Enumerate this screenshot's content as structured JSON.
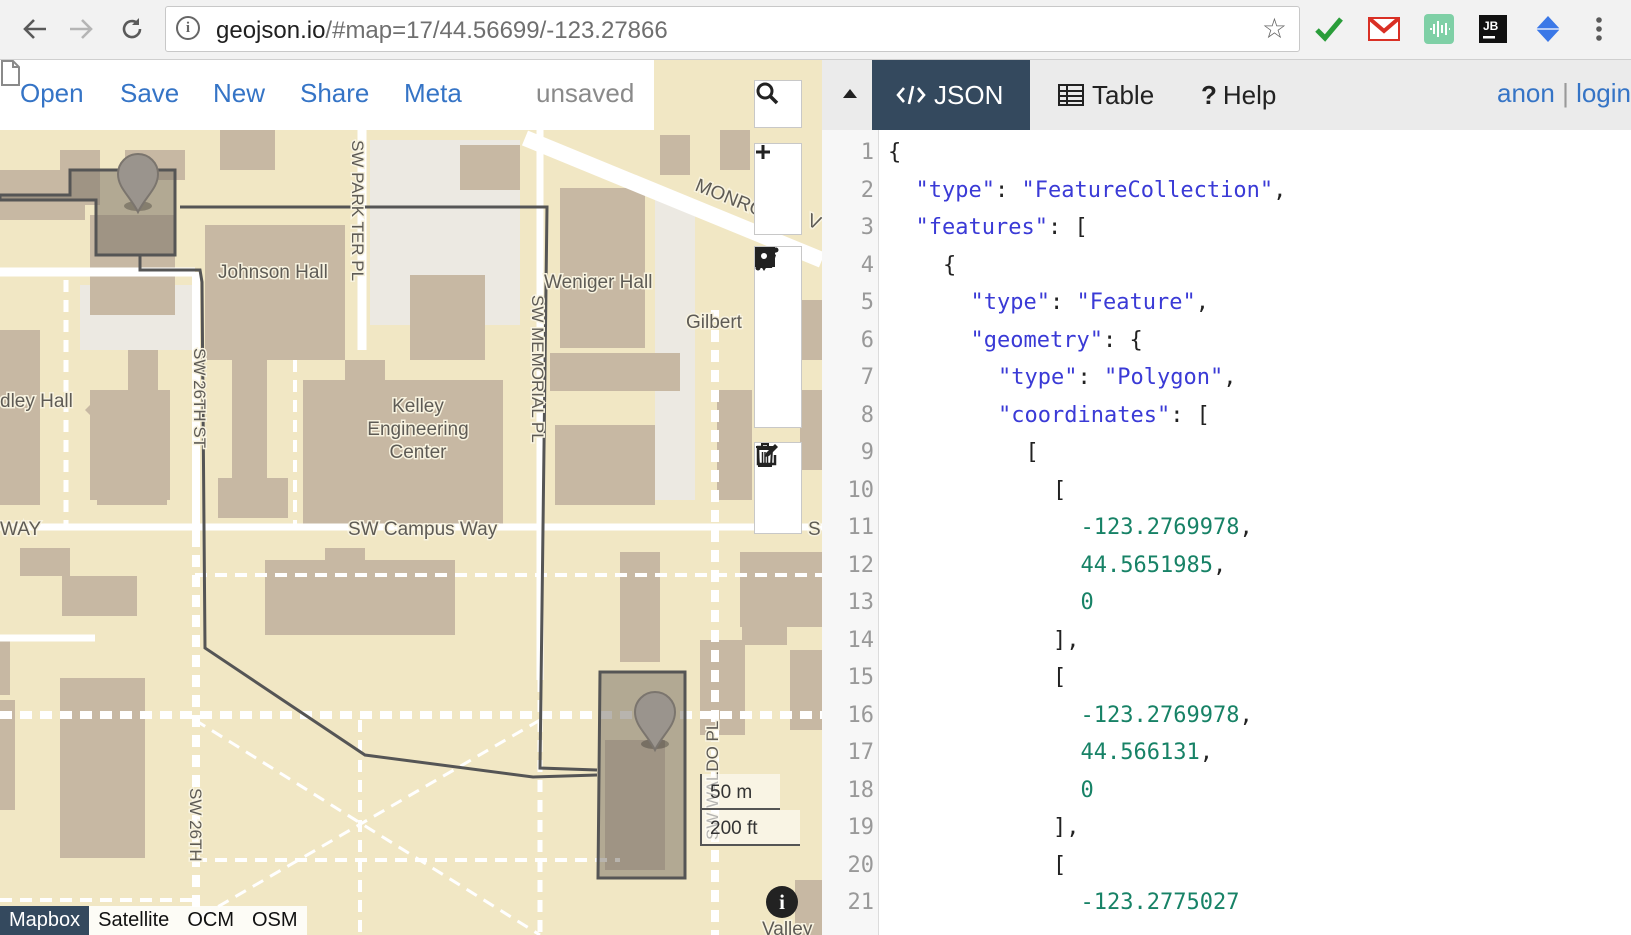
{
  "browser": {
    "url_host": "geojson.io",
    "url_rest": "/#map=17/44.56699/-123.27866"
  },
  "app": {
    "menu": {
      "open": "Open",
      "save": "Save",
      "new": "New",
      "share": "Share",
      "meta": "Meta",
      "unsaved": "unsaved"
    },
    "tabs": {
      "json": "JSON",
      "table": "Table",
      "help": "Help"
    },
    "account": {
      "anon": "anon",
      "sep": "|",
      "login": "login"
    }
  },
  "map": {
    "labels": {
      "johnson_hall": "Johnson Hall",
      "weniger_hall": "Weniger Hall",
      "gilbert": "Gilbert",
      "dley_hall": "dley Hall",
      "kelley_1": "Kelley",
      "kelley_2": "Engineering",
      "kelley_3": "Center",
      "campus_way": "SW Campus Way",
      "way": "WAY",
      "park_ter": "SW PARK TER PL",
      "memorial": "SW MEMORIAL PL",
      "sw26th_a": "SW 26TH ST",
      "sw26th_b": "SW 26TH",
      "waldo": "SW WALDO PL",
      "monroe": "MONRO",
      "valley": "Valley",
      "sw_s": "S",
      "sw_v": "V"
    },
    "scale": {
      "metric": "50 m",
      "imperial": "200 ft"
    },
    "layers": [
      "Mapbox",
      "Satellite",
      "OCM",
      "OSM"
    ],
    "active_layer": "Mapbox"
  },
  "editor": {
    "lines": [
      {
        "n": "1",
        "indent": 0,
        "tokens": [
          [
            "p",
            "{"
          ]
        ]
      },
      {
        "n": "2",
        "indent": 1,
        "tokens": [
          [
            "k",
            "\"type\""
          ],
          [
            "p",
            ": "
          ],
          [
            "s",
            "\"FeatureCollection\""
          ],
          [
            "p",
            ","
          ]
        ]
      },
      {
        "n": "3",
        "indent": 1,
        "tokens": [
          [
            "k",
            "\"features\""
          ],
          [
            "p",
            ": ["
          ]
        ]
      },
      {
        "n": "4",
        "indent": 2,
        "tokens": [
          [
            "p",
            "{"
          ]
        ]
      },
      {
        "n": "5",
        "indent": 3,
        "tokens": [
          [
            "k",
            "\"type\""
          ],
          [
            "p",
            ": "
          ],
          [
            "s",
            "\"Feature\""
          ],
          [
            "p",
            ","
          ]
        ]
      },
      {
        "n": "6",
        "indent": 3,
        "tokens": [
          [
            "k",
            "\"geometry\""
          ],
          [
            "p",
            ": {"
          ]
        ]
      },
      {
        "n": "7",
        "indent": 4,
        "tokens": [
          [
            "k",
            "\"type\""
          ],
          [
            "p",
            ": "
          ],
          [
            "s",
            "\"Polygon\""
          ],
          [
            "p",
            ","
          ]
        ]
      },
      {
        "n": "8",
        "indent": 4,
        "tokens": [
          [
            "k",
            "\"coordinates\""
          ],
          [
            "p",
            ": ["
          ]
        ]
      },
      {
        "n": "9",
        "indent": 5,
        "tokens": [
          [
            "p",
            "["
          ]
        ]
      },
      {
        "n": "10",
        "indent": 6,
        "tokens": [
          [
            "p",
            "["
          ]
        ]
      },
      {
        "n": "11",
        "indent": 7,
        "tokens": [
          [
            "n",
            "-123.2769978"
          ],
          [
            "p",
            ","
          ]
        ]
      },
      {
        "n": "12",
        "indent": 7,
        "tokens": [
          [
            "n",
            "44.5651985"
          ],
          [
            "p",
            ","
          ]
        ]
      },
      {
        "n": "13",
        "indent": 7,
        "tokens": [
          [
            "n",
            "0"
          ]
        ]
      },
      {
        "n": "14",
        "indent": 6,
        "tokens": [
          [
            "p",
            "],"
          ]
        ]
      },
      {
        "n": "15",
        "indent": 6,
        "tokens": [
          [
            "p",
            "["
          ]
        ]
      },
      {
        "n": "16",
        "indent": 7,
        "tokens": [
          [
            "n",
            "-123.2769978"
          ],
          [
            "p",
            ","
          ]
        ]
      },
      {
        "n": "17",
        "indent": 7,
        "tokens": [
          [
            "n",
            "44.566131"
          ],
          [
            "p",
            ","
          ]
        ]
      },
      {
        "n": "18",
        "indent": 7,
        "tokens": [
          [
            "n",
            "0"
          ]
        ]
      },
      {
        "n": "19",
        "indent": 6,
        "tokens": [
          [
            "p",
            "],"
          ]
        ]
      },
      {
        "n": "20",
        "indent": 6,
        "tokens": [
          [
            "p",
            "["
          ]
        ]
      },
      {
        "n": "21",
        "indent": 7,
        "tokens": [
          [
            "n",
            "-123.2775027"
          ]
        ]
      }
    ]
  },
  "colors": {
    "accent": "#3574c6",
    "tab_active": "#34495e",
    "json_key": "#3a3ad6",
    "json_number": "#178266",
    "map_land": "#f1e7c4",
    "building": "#c7b8a3"
  }
}
